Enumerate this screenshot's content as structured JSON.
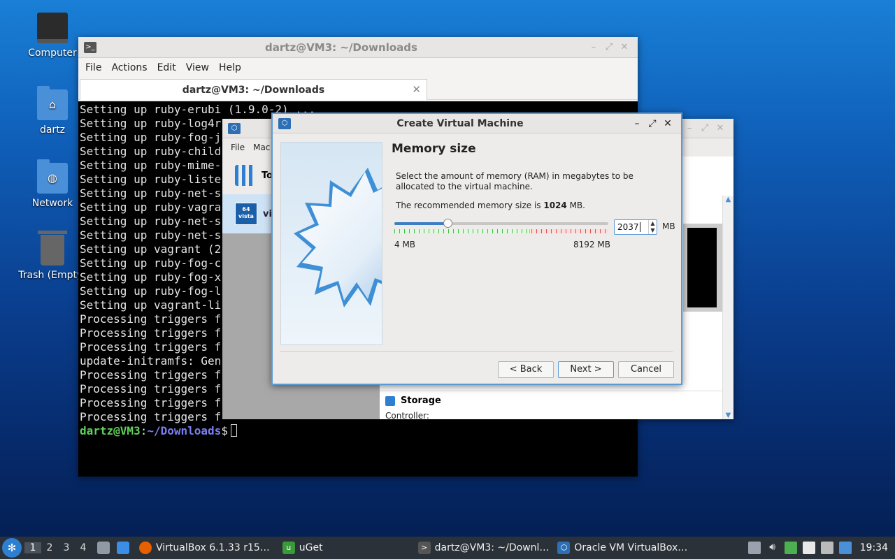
{
  "desktop": {
    "icons": [
      {
        "label": "Computer"
      },
      {
        "label": "dartz"
      },
      {
        "label": "Network"
      },
      {
        "label": "Trash (Empty)"
      }
    ]
  },
  "terminal": {
    "window_title": "dartz@VM3: ~/Downloads",
    "menu": [
      "File",
      "Actions",
      "Edit",
      "View",
      "Help"
    ],
    "tab_title": "dartz@VM3: ~/Downloads",
    "lines": [
      "Setting up ruby-erubi (1.9.0-2) ...",
      "Setting up ruby-log4r",
      "Setting up ruby-fog-j",
      "Setting up ruby-child",
      "Setting up ruby-mime-",
      "Setting up ruby-liste",
      "Setting up ruby-net-s",
      "Setting up ruby-vagra",
      "Setting up ruby-net-s",
      "Setting up ruby-net-s",
      "Setting up vagrant (2",
      "Setting up ruby-fog-c",
      "Setting up ruby-fog-x",
      "Setting up ruby-fog-l",
      "Setting up vagrant-li",
      "Processing triggers f",
      "Processing triggers f",
      "Processing triggers f",
      "update-initramfs: Gen",
      "Processing triggers f",
      "Processing triggers f",
      "Processing triggers f",
      "Processing triggers f"
    ],
    "prompt_user": "dartz@VM3",
    "prompt_sep": ":",
    "prompt_path": "~/Downloads",
    "prompt_symbol": "$"
  },
  "vbox_manager": {
    "menu": [
      "File",
      "Mac"
    ],
    "tools_label": "To",
    "vm_label": "vi",
    "vm_badge": "64 vista",
    "storage_label": "Storage",
    "controller_label": "Controller:"
  },
  "dialog": {
    "title": "Create Virtual Machine",
    "heading": "Memory size",
    "description": "Select the amount of memory (RAM) in megabytes to be allocated to the virtual machine.",
    "recommend_prefix": "The recommended memory size is ",
    "recommend_value": "1024",
    "recommend_suffix": " MB.",
    "memory_value": "2037",
    "memory_unit": "MB",
    "slider_min_label": "4 MB",
    "slider_max_label": "8192 MB",
    "slider_min": 4,
    "slider_max": 8192,
    "slider_value": 2037,
    "back_label": "< Back",
    "next_label": "Next >",
    "cancel_label": "Cancel",
    "accent_color": "#3d7fc2"
  },
  "taskbar": {
    "workspaces": [
      "1",
      "2",
      "3",
      "4"
    ],
    "active_workspace": "1",
    "tasks": [
      {
        "label": "VirtualBox 6.1.33 r15…",
        "icon": "firefox-icon"
      },
      {
        "label": "uGet",
        "icon": "uget-icon"
      },
      {
        "label": "dartz@VM3: ~/Downl…",
        "icon": "terminal-icon"
      },
      {
        "label": "Oracle VM VirtualBox…",
        "icon": "virtualbox-icon"
      }
    ],
    "clock": "19:34"
  }
}
